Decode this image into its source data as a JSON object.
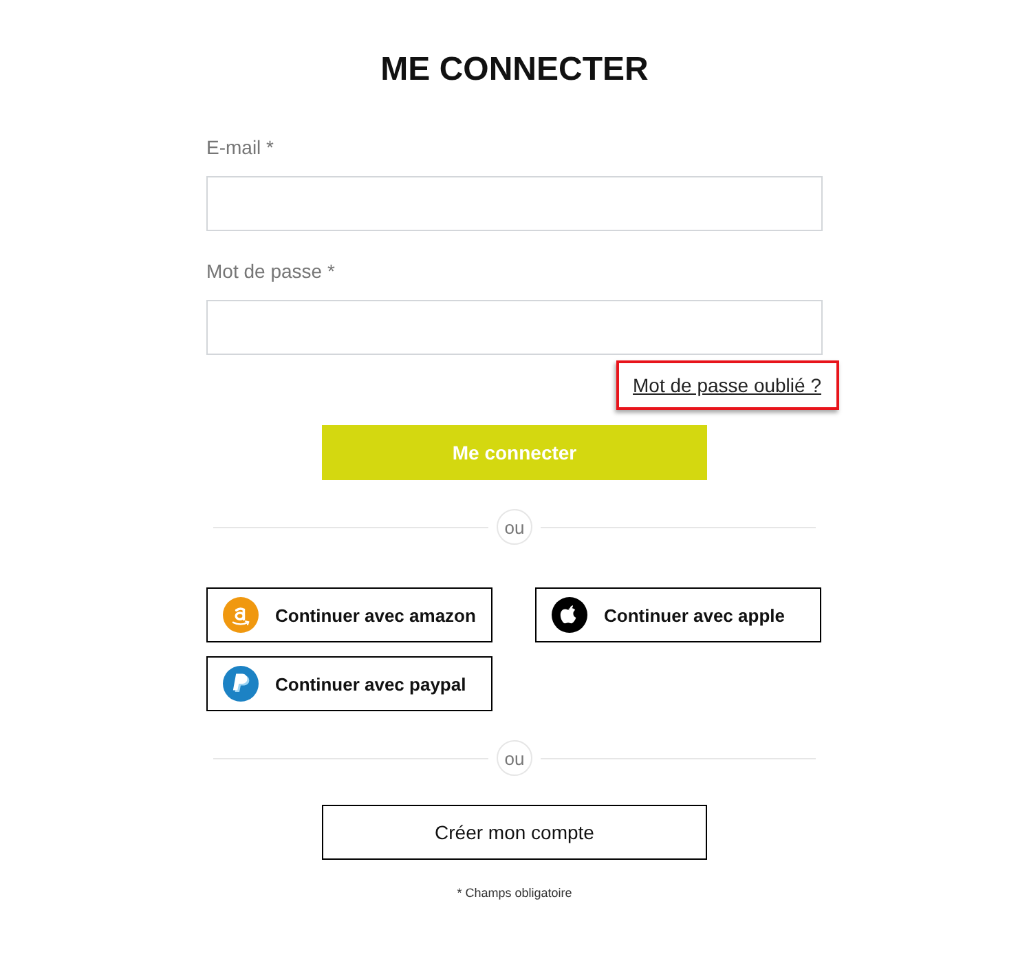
{
  "title": "ME CONNECTER",
  "fields": [
    {
      "label": "E-mail *"
    },
    {
      "label": "Mot de passe *"
    }
  ],
  "forgot_link": {
    "text": "Mot de passe oublié ?",
    "highlighted": true
  },
  "login_button": "Me connecter",
  "separator_1": "ou",
  "social_buttons": [
    {
      "label": "Continuer avec amazon",
      "kind": "amazon"
    },
    {
      "label": "Continuer avec apple",
      "kind": "apple"
    },
    {
      "label": "Continuer avec paypal",
      "kind": "paypal"
    }
  ],
  "separator_2": "ou",
  "create_account_button": "Créer mon compte",
  "footnote": "* Champs obligatoire"
}
